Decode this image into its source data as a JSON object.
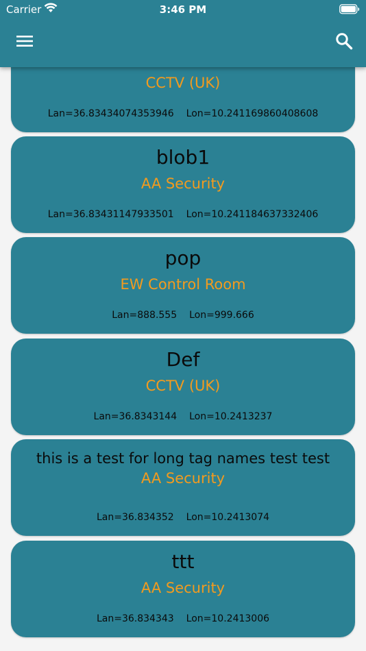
{
  "status_bar": {
    "carrier": "Carrier",
    "time": "3:46 PM"
  },
  "colors": {
    "primary": "#2b8194",
    "accent": "#f39b1e",
    "text": "#0a0a0a"
  },
  "header": {
    "menu_icon": "hamburger-menu-icon",
    "search_icon": "search-icon"
  },
  "tags": [
    {
      "name": "",
      "company": "CCTV (UK)",
      "lan": "Lan=36.83434074353946",
      "lon": "Lon=10.241169860408608"
    },
    {
      "name": "blob1",
      "company": "AA Security",
      "lan": "Lan=36.83431147933501",
      "lon": "Lon=10.241184637332406"
    },
    {
      "name": "pop",
      "company": "EW Control Room",
      "lan": "Lan=888.555",
      "lon": "Lon=999.666"
    },
    {
      "name": "Def",
      "company": "CCTV (UK)",
      "lan": "Lan=36.8343144",
      "lon": "Lon=10.2413237"
    },
    {
      "name": "this is a test for long tag names test test",
      "company": "AA Security",
      "lan": "Lan=36.834352",
      "lon": "Lon=10.2413074"
    },
    {
      "name": "ttt",
      "company": "AA Security",
      "lan": "Lan=36.834343",
      "lon": "Lon=10.2413006"
    }
  ]
}
